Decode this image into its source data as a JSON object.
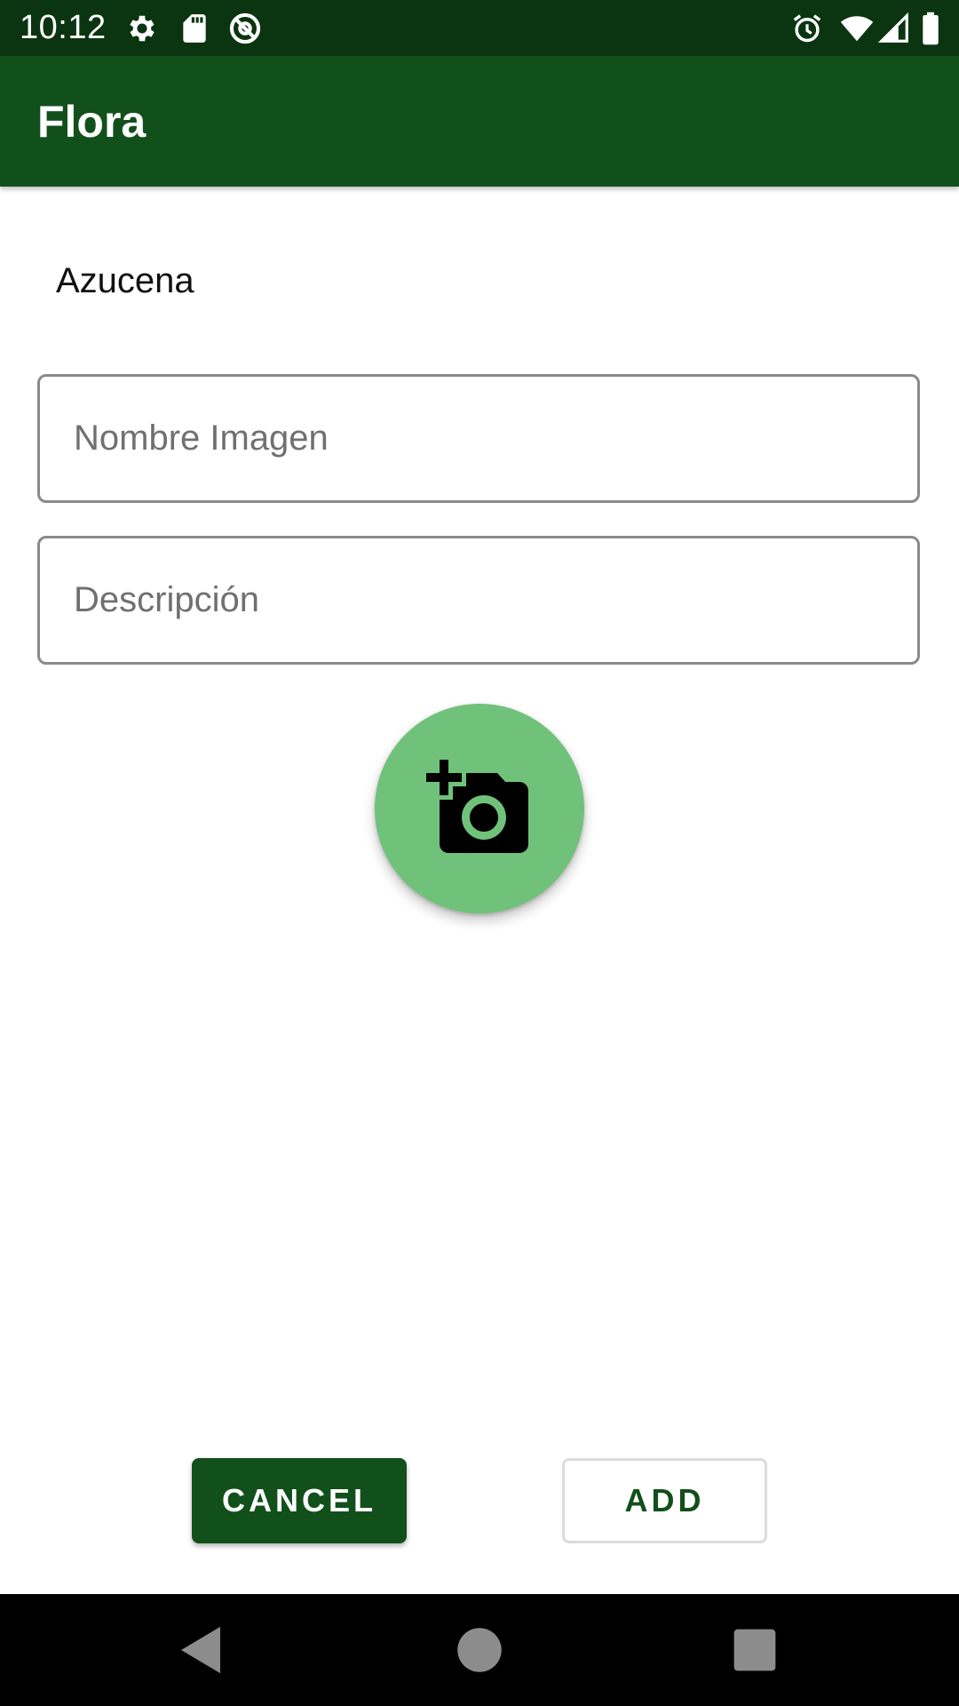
{
  "status_bar": {
    "time": "10:12",
    "left_icons": [
      "gear-icon",
      "sd-card-icon",
      "at-sign-icon"
    ],
    "right_icons": [
      "alarm-icon",
      "wifi-icon",
      "signal-icon",
      "battery-icon"
    ]
  },
  "app_bar": {
    "title": "Flora"
  },
  "form": {
    "plant_name": "Azucena",
    "image_name": {
      "value": "",
      "placeholder": "Nombre Imagen"
    },
    "description": {
      "value": "",
      "placeholder": "Descripción"
    },
    "fab_icon": "add-a-photo-icon"
  },
  "actions": {
    "cancel_label": "CANCEL",
    "add_label": "ADD"
  },
  "nav_bar": {
    "buttons": [
      "back-icon",
      "home-icon",
      "recents-icon"
    ]
  },
  "colors": {
    "status_bar": "#0b3510",
    "primary": "#12501b",
    "fab": "#70c27b",
    "field_border": "#8a8a8a"
  }
}
